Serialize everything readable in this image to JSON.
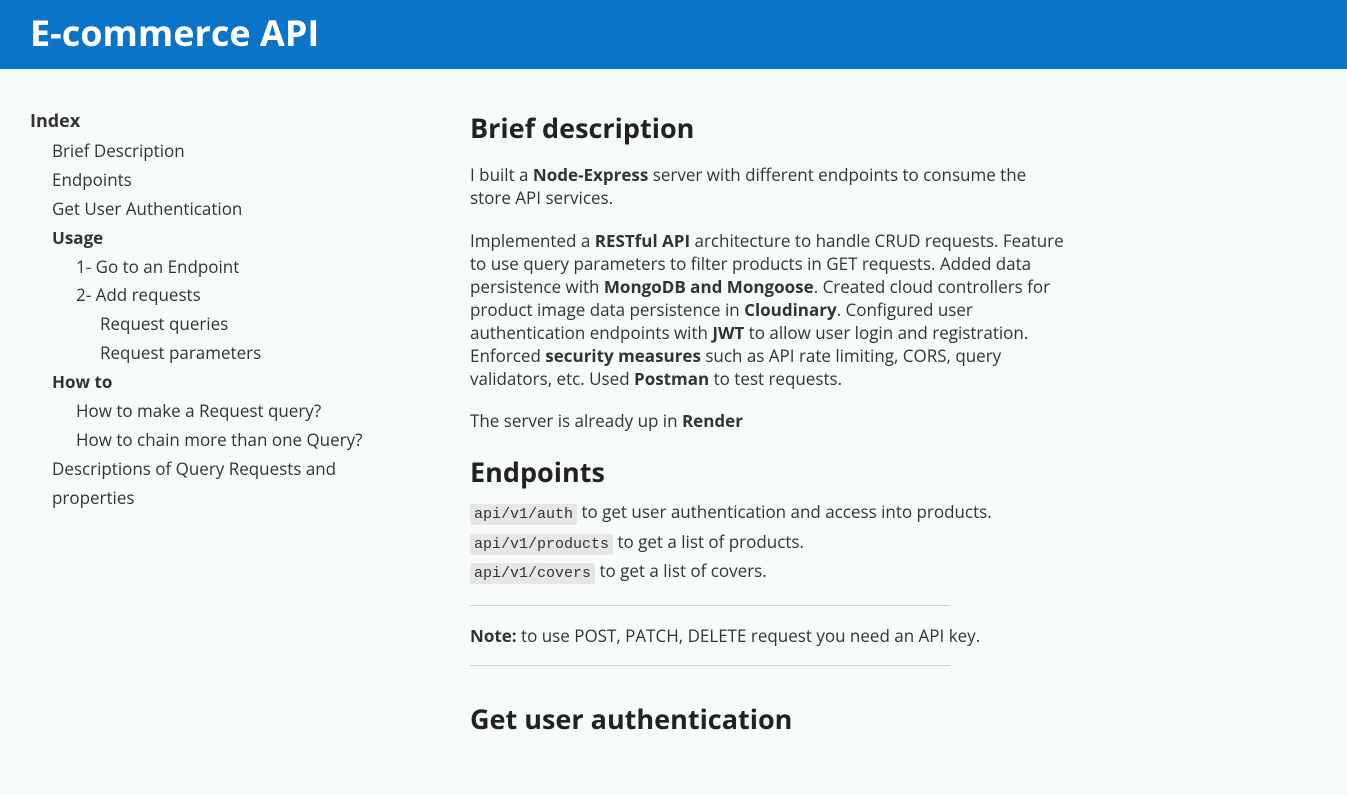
{
  "header": {
    "title": "E-commerce API"
  },
  "sidebar": {
    "indexLabel": "Index",
    "items": {
      "brief": "Brief Description",
      "endpoints": "Endpoints",
      "getAuth": "Get User Authentication",
      "usage": "Usage",
      "usageChildren": {
        "goEndpoint": "1- Go to an Endpoint",
        "addRequests": "2- Add requests",
        "reqQueries": "Request queries",
        "reqParams": "Request parameters"
      },
      "howTo": "How to",
      "howToChildren": {
        "makeQuery": "How to make a Request query?",
        "chainQuery": "How to chain more than one Query?"
      },
      "descriptions": "Descriptions of Query Requests and properties"
    }
  },
  "main": {
    "briefTitle": "Brief description",
    "p1_a": "I built a ",
    "p1_b_bold": "Node-Express",
    "p1_c": " server with different endpoints to consume the store API services.",
    "p2_a": "Implemented a ",
    "p2_b_bold": "RESTful API",
    "p2_c": " architecture to handle CRUD requests. Feature to use query parameters to filter products in GET requests. Added data persistence with ",
    "p2_d_bold": "MongoDB and Mongoose",
    "p2_e": ". Created cloud controllers for product image data persistence in ",
    "p2_f_bold": "Cloudinary",
    "p2_g": ". Configured user authentication endpoints with ",
    "p2_h_bold": "JWT",
    "p2_i": " to allow user login and registration. Enforced ",
    "p2_j_bold": "security measures",
    "p2_k": " such as API rate limiting, CORS, query validators, etc. Used ",
    "p2_l_bold": "Postman",
    "p2_m": " to test requests.",
    "p3_a": "The server is already up in ",
    "p3_b_bold": "Render",
    "endpointsTitle": "Endpoints",
    "ep1_code": "api/v1/auth",
    "ep1_text": " to get user authentication and access into products.",
    "ep2_code": "api/v1/products",
    "ep2_text": " to get a list of products.",
    "ep3_code": "api/v1/covers",
    "ep3_text": " to get a list of covers.",
    "note_bold": "Note:",
    "note_text": " to use POST, PATCH, DELETE request you need an API key.",
    "getAuthPartial": "Get user authentication"
  }
}
